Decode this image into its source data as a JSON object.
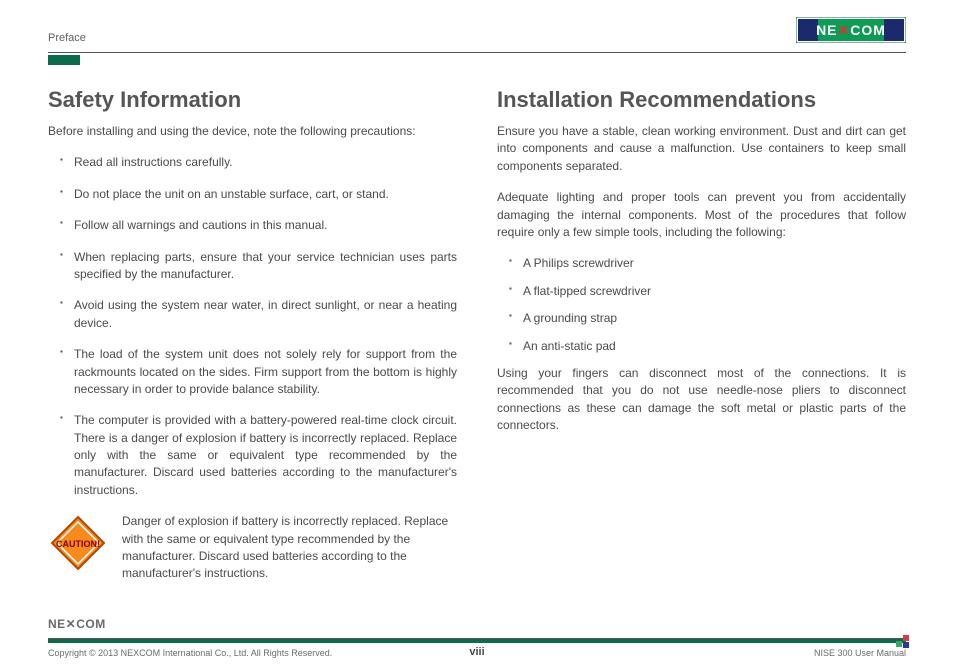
{
  "header": {
    "section": "Preface"
  },
  "left": {
    "heading": "Safety Information",
    "intro": "Before installing and using the device, note the following precautions:",
    "bullets": [
      "Read all instructions carefully.",
      "Do not place the unit on an unstable surface, cart, or stand.",
      "Follow all warnings and cautions in this manual.",
      "When replacing parts, ensure that your service technician uses parts specified by the manufacturer.",
      "Avoid using the system near water, in direct sunlight, or near a heating device.",
      "The load of the system unit does not solely rely for support from the rackmounts located on the sides. Firm support from the bottom is highly necessary in order to provide balance stability.",
      "The computer is provided with a battery-powered real-time clock circuit. There is a danger of explosion if battery is incorrectly replaced. Replace only with the same or equivalent type recommended by the manufacturer. Discard used batteries according to the manufacturer's instructions."
    ],
    "caution_label": "CAUTION!",
    "caution_text": "Danger of explosion if battery is incorrectly replaced. Replace with the same or equivalent type recommended by the manufacturer. Discard used batteries according to the manufacturer's instructions."
  },
  "right": {
    "heading": "Installation Recommendations",
    "para1": "Ensure you have a stable, clean working environment. Dust and dirt can get into components and cause a malfunction. Use containers to keep small components separated.",
    "para2": "Adequate lighting and proper tools can prevent you from accidentally damaging the internal components. Most of the procedures that follow require only a few simple tools, including the following:",
    "tools": [
      "A Philips screwdriver",
      "A flat-tipped screwdriver",
      "A grounding strap",
      "An anti-static pad"
    ],
    "para3": "Using your fingers can disconnect most of the connections. It is recommended that you do not use needle-nose pliers to disconnect connections as these can damage the soft metal or plastic parts of the connectors."
  },
  "footer": {
    "copyright": "Copyright © 2013 NEXCOM International Co., Ltd. All Rights Reserved.",
    "page_number": "viii",
    "doc_title": "NISE 300 User Manual"
  },
  "brand": {
    "name": "NEXCOM"
  }
}
